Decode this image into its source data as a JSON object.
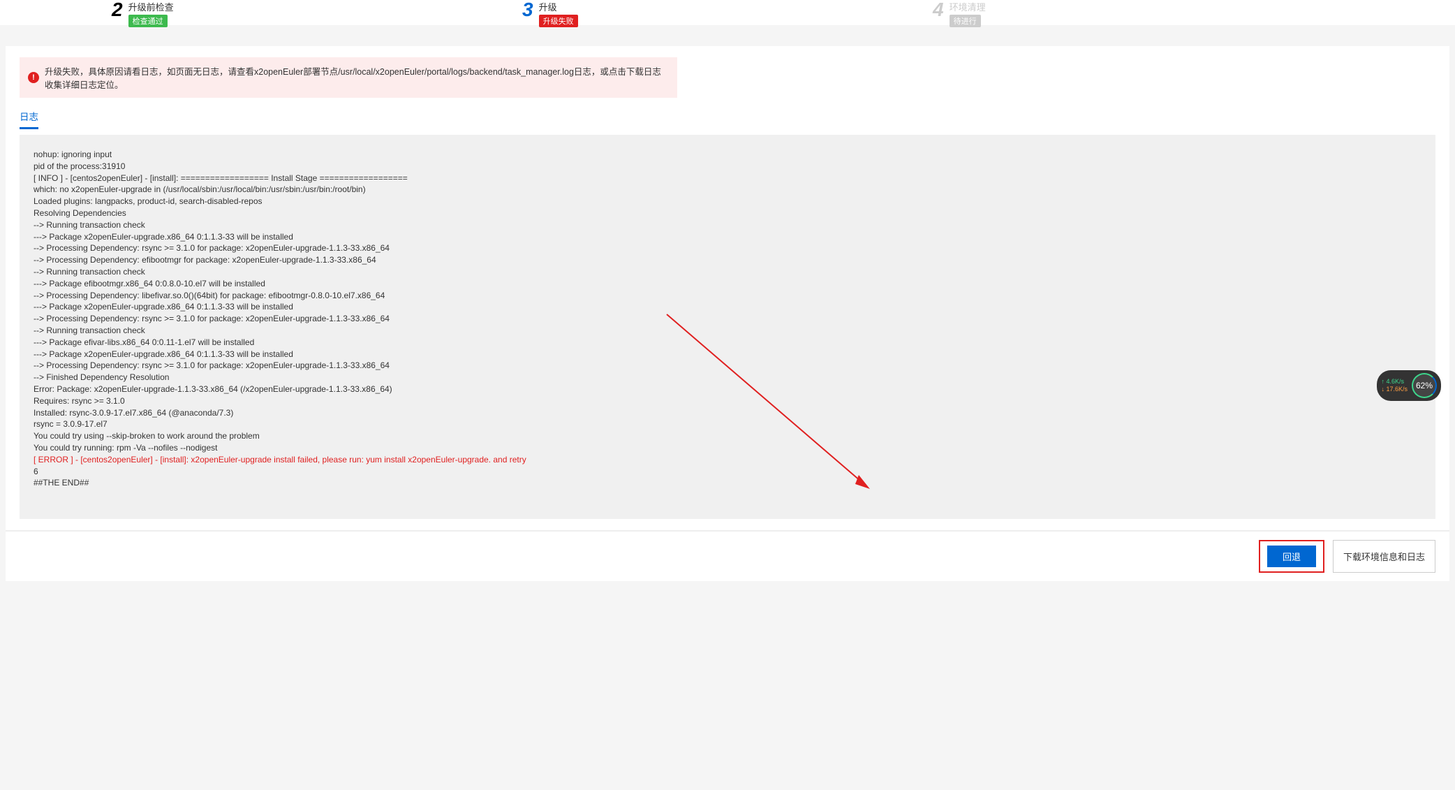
{
  "steps": [
    {
      "num": "2",
      "title": "升级前检查",
      "badge": "检查通过",
      "badgeClass": "badge-green",
      "numClass": "done",
      "titleClass": ""
    },
    {
      "num": "3",
      "title": "升级",
      "badge": "升级失败",
      "badgeClass": "badge-red",
      "numClass": "active",
      "titleClass": ""
    },
    {
      "num": "4",
      "title": "环境清理",
      "badge": "待进行",
      "badgeClass": "badge-gray",
      "numClass": "pending",
      "titleClass": "pending"
    }
  ],
  "alert": {
    "icon": "!",
    "text": "升级失败，具体原因请看日志，如页面无日志，请查看x2openEuler部署节点/usr/local/x2openEuler/portal/logs/backend/task_manager.log日志，或点击下载日志收集详细日志定位。"
  },
  "tab": {
    "active": "日志"
  },
  "log": {
    "lines": [
      "nohup: ignoring input",
      "pid of the process:31910",
      "[ INFO ] - [centos2openEuler] - [install]: ================== Install Stage ==================",
      "which: no x2openEuler-upgrade in (/usr/local/sbin:/usr/local/bin:/usr/sbin:/usr/bin:/root/bin)",
      "Loaded plugins: langpacks, product-id, search-disabled-repos",
      "Resolving Dependencies",
      "--> Running transaction check",
      "---> Package x2openEuler-upgrade.x86_64 0:1.1.3-33 will be installed",
      "--> Processing Dependency: rsync >= 3.1.0 for package: x2openEuler-upgrade-1.1.3-33.x86_64",
      "--> Processing Dependency: efibootmgr for package: x2openEuler-upgrade-1.1.3-33.x86_64",
      "--> Running transaction check",
      "---> Package efibootmgr.x86_64 0:0.8.0-10.el7 will be installed",
      "--> Processing Dependency: libefivar.so.0()(64bit) for package: efibootmgr-0.8.0-10.el7.x86_64",
      "---> Package x2openEuler-upgrade.x86_64 0:1.1.3-33 will be installed",
      "--> Processing Dependency: rsync >= 3.1.0 for package: x2openEuler-upgrade-1.1.3-33.x86_64",
      "--> Running transaction check",
      "---> Package efivar-libs.x86_64 0:0.11-1.el7 will be installed",
      "---> Package x2openEuler-upgrade.x86_64 0:1.1.3-33 will be installed",
      "--> Processing Dependency: rsync >= 3.1.0 for package: x2openEuler-upgrade-1.1.3-33.x86_64",
      "--> Finished Dependency Resolution",
      "Error: Package: x2openEuler-upgrade-1.1.3-33.x86_64 (/x2openEuler-upgrade-1.1.3-33.x86_64)",
      "Requires: rsync >= 3.1.0",
      "Installed: rsync-3.0.9-17.el7.x86_64 (@anaconda/7.3)",
      "rsync = 3.0.9-17.el7",
      "You could try using --skip-broken to work around the problem",
      "You could try running: rpm -Va --nofiles --nodigest"
    ],
    "error_line": "[ ERROR ] - [centos2openEuler] - [install]: x2openEuler-upgrade install failed, please run: yum install x2openEuler-upgrade. and retry",
    "tail": [
      "6",
      "##THE END##"
    ]
  },
  "footer": {
    "rollback_label": "回退",
    "download_label": "下载环境信息和日志"
  },
  "widget": {
    "up": "↑ 4.6K/s",
    "down": "↓ 17.6K/s",
    "percent": "62%"
  }
}
